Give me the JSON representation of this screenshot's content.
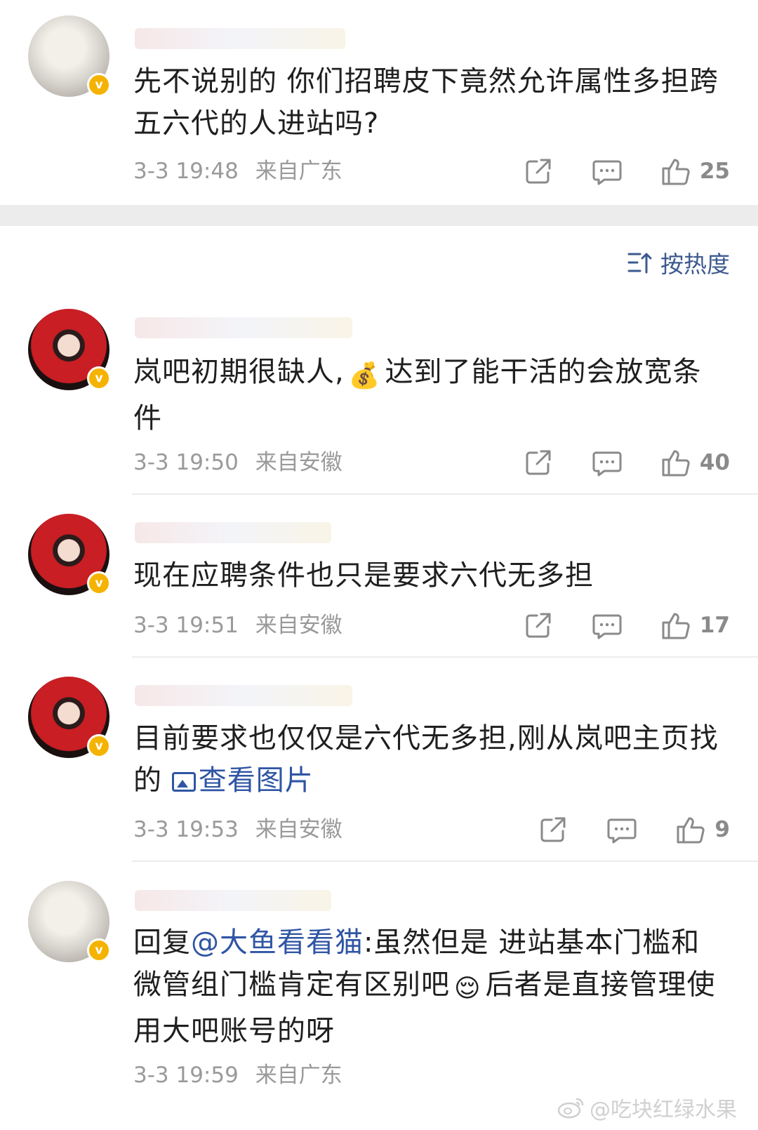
{
  "comments": [
    {
      "avatar_style": "light",
      "text": "先不说别的 你们招聘皮下竟然允许属性多担跨五六代的人进站吗?",
      "time": "3-3 19:48",
      "location": "来自广东",
      "likes": "25"
    },
    {
      "avatar_style": "red",
      "text_before": "岚吧初期很缺人,",
      "emoji": "💰",
      "text_after": "达到了能干活的会放宽条件",
      "time": "3-3 19:50",
      "location": "来自安徽",
      "likes": "40"
    },
    {
      "avatar_style": "red",
      "text": "现在应聘条件也只是要求六代无多担",
      "time": "3-3 19:51",
      "location": "来自安徽",
      "likes": "17"
    },
    {
      "avatar_style": "red",
      "text_before": "目前要求也仅仅是六代无多担,刚从岚吧主页找的",
      "link": "查看图片",
      "time": "3-3 19:53",
      "location": "来自安徽",
      "likes": "9"
    },
    {
      "avatar_style": "light",
      "reply_prefix": "回复",
      "mention": "@大鱼看看猫",
      "text_before": ":虽然但是 进站基本门槛和微管组门槛肯定有区别吧",
      "emoji": "😌",
      "text_after": "后者是直接管理使用大吧账号的呀",
      "time": "3-3 19:59",
      "location": "来自广东"
    }
  ],
  "sort": {
    "label": "按热度"
  },
  "watermark": {
    "text": "@吃块红绿水果"
  },
  "icons": {
    "share": "share-icon",
    "comment": "comment-icon",
    "like": "thumbs-up-icon",
    "sort": "sort-icon",
    "verified": "verified-badge-icon"
  },
  "colors": {
    "link": "#2f55a4",
    "meta": "#9a9a9a",
    "badge": "#f5b301",
    "separator": "#ececec"
  }
}
